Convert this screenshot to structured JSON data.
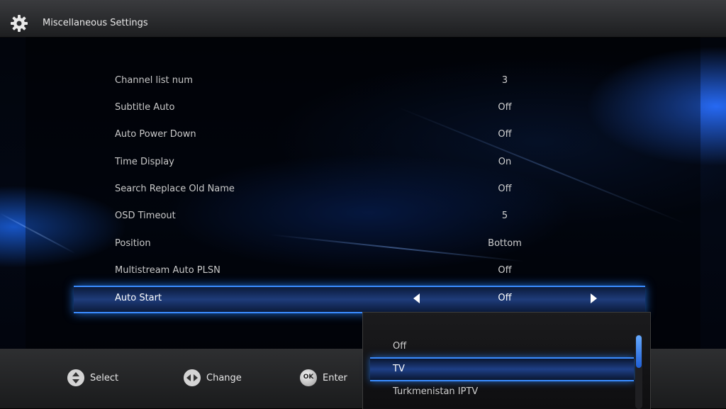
{
  "header": {
    "title": "Miscellaneous Settings",
    "icon": "gear-icon"
  },
  "settings": [
    {
      "label": "Channel list num",
      "value": "3"
    },
    {
      "label": "Subtitle Auto",
      "value": "Off"
    },
    {
      "label": "Auto Power Down",
      "value": "Off"
    },
    {
      "label": "Time Display",
      "value": "On"
    },
    {
      "label": "Search Replace Old Name",
      "value": "Off"
    },
    {
      "label": "OSD Timeout",
      "value": "5"
    },
    {
      "label": "Position",
      "value": "Bottom"
    },
    {
      "label": "Multistream Auto PLSN",
      "value": "Off"
    }
  ],
  "selected": {
    "label": "Auto Start",
    "value": "Off"
  },
  "dropdown": {
    "options": [
      "Off",
      "TV",
      "Turkmenistan IPTV"
    ],
    "highlighted": "TV"
  },
  "footer": {
    "select_label": "Select",
    "change_label": "Change",
    "enter_label": "Enter",
    "ok_text": "OK"
  },
  "colors": {
    "accent": "#3a8cff",
    "highlight_bg": "#1e3c7a"
  }
}
